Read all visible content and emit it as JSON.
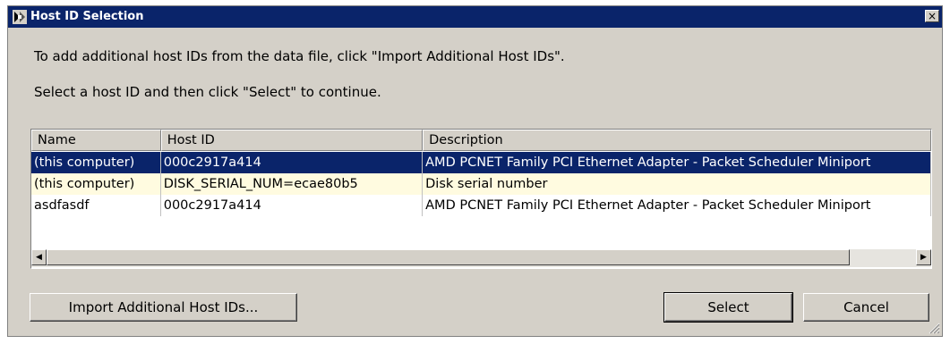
{
  "window": {
    "title": "Host ID Selection",
    "close_label": "×"
  },
  "instructions": {
    "line1": "To add additional host IDs from the data file, click \"Import Additional Host IDs\".",
    "line2": "Select a host ID and then click \"Select\" to continue."
  },
  "table": {
    "columns": [
      "Name",
      "Host ID",
      "Description"
    ],
    "rows": [
      {
        "name": "(this computer)",
        "host_id": "000c2917a414",
        "description": "AMD PCNET Family PCI Ethernet Adapter - Packet Scheduler Miniport",
        "state": "selected"
      },
      {
        "name": "(this computer)",
        "host_id": "DISK_SERIAL_NUM=ecae80b5",
        "description": "Disk serial number",
        "state": "highlighted"
      },
      {
        "name": "asdfasdf",
        "host_id": "000c2917a414",
        "description": "AMD PCNET Family PCI Ethernet Adapter - Packet Scheduler Miniport",
        "state": "normal"
      }
    ]
  },
  "scrollbar": {
    "left_arrow": "◀",
    "right_arrow": "▶"
  },
  "buttons": {
    "import": "Import Additional Host IDs...",
    "select": "Select",
    "cancel": "Cancel"
  },
  "colors": {
    "titlebar": "#0a246a",
    "selection": "#0a246a",
    "highlight_row": "#fffbe0",
    "face": "#d4d0c8"
  }
}
